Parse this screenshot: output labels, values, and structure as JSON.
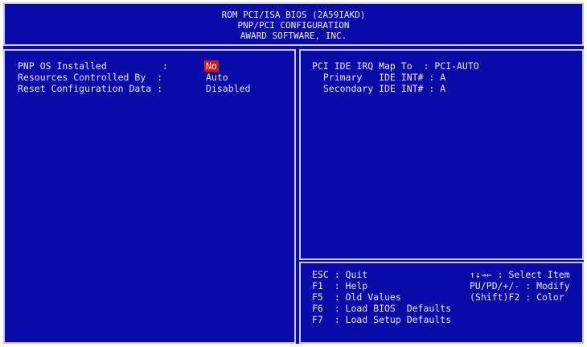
{
  "header": {
    "line1": "ROM PCI/ISA BIOS (2A59IAKD)",
    "line2": "PNP/PCI CONFIGURATION",
    "line3": "AWARD SOFTWARE, INC."
  },
  "left_panel": {
    "items": [
      {
        "label": "PNP OS Installed          :",
        "value": "No",
        "selected": true
      },
      {
        "label": "Resources Controlled By  :",
        "value": "Auto",
        "selected": false
      },
      {
        "label": "Reset Configuration Data :",
        "value": "Disabled",
        "selected": false
      }
    ]
  },
  "right_panel": {
    "items": [
      {
        "text": "PCI IDE IRQ Map To  : PCI-AUTO"
      },
      {
        "text": "  Primary   IDE INT# : A"
      },
      {
        "text": "  Secondary IDE INT# : A"
      }
    ]
  },
  "help": {
    "lines": [
      {
        "left": "ESC : Quit",
        "right": "↑↓→← : Select Item"
      },
      {
        "left": "F1  : Help",
        "right": "PU/PD/+/- : Modify"
      },
      {
        "left": "F5  : Old Values",
        "right": "(Shift)F2 : Color"
      },
      {
        "left": "F6  : Load BIOS  Defaults",
        "right": ""
      },
      {
        "left": "F7  : Load Setup Defaults",
        "right": ""
      }
    ]
  },
  "colors": {
    "background": "#0a0aa8",
    "border": "#c8c8e0",
    "text": "#e8e8f8",
    "highlight": "#d01818"
  }
}
